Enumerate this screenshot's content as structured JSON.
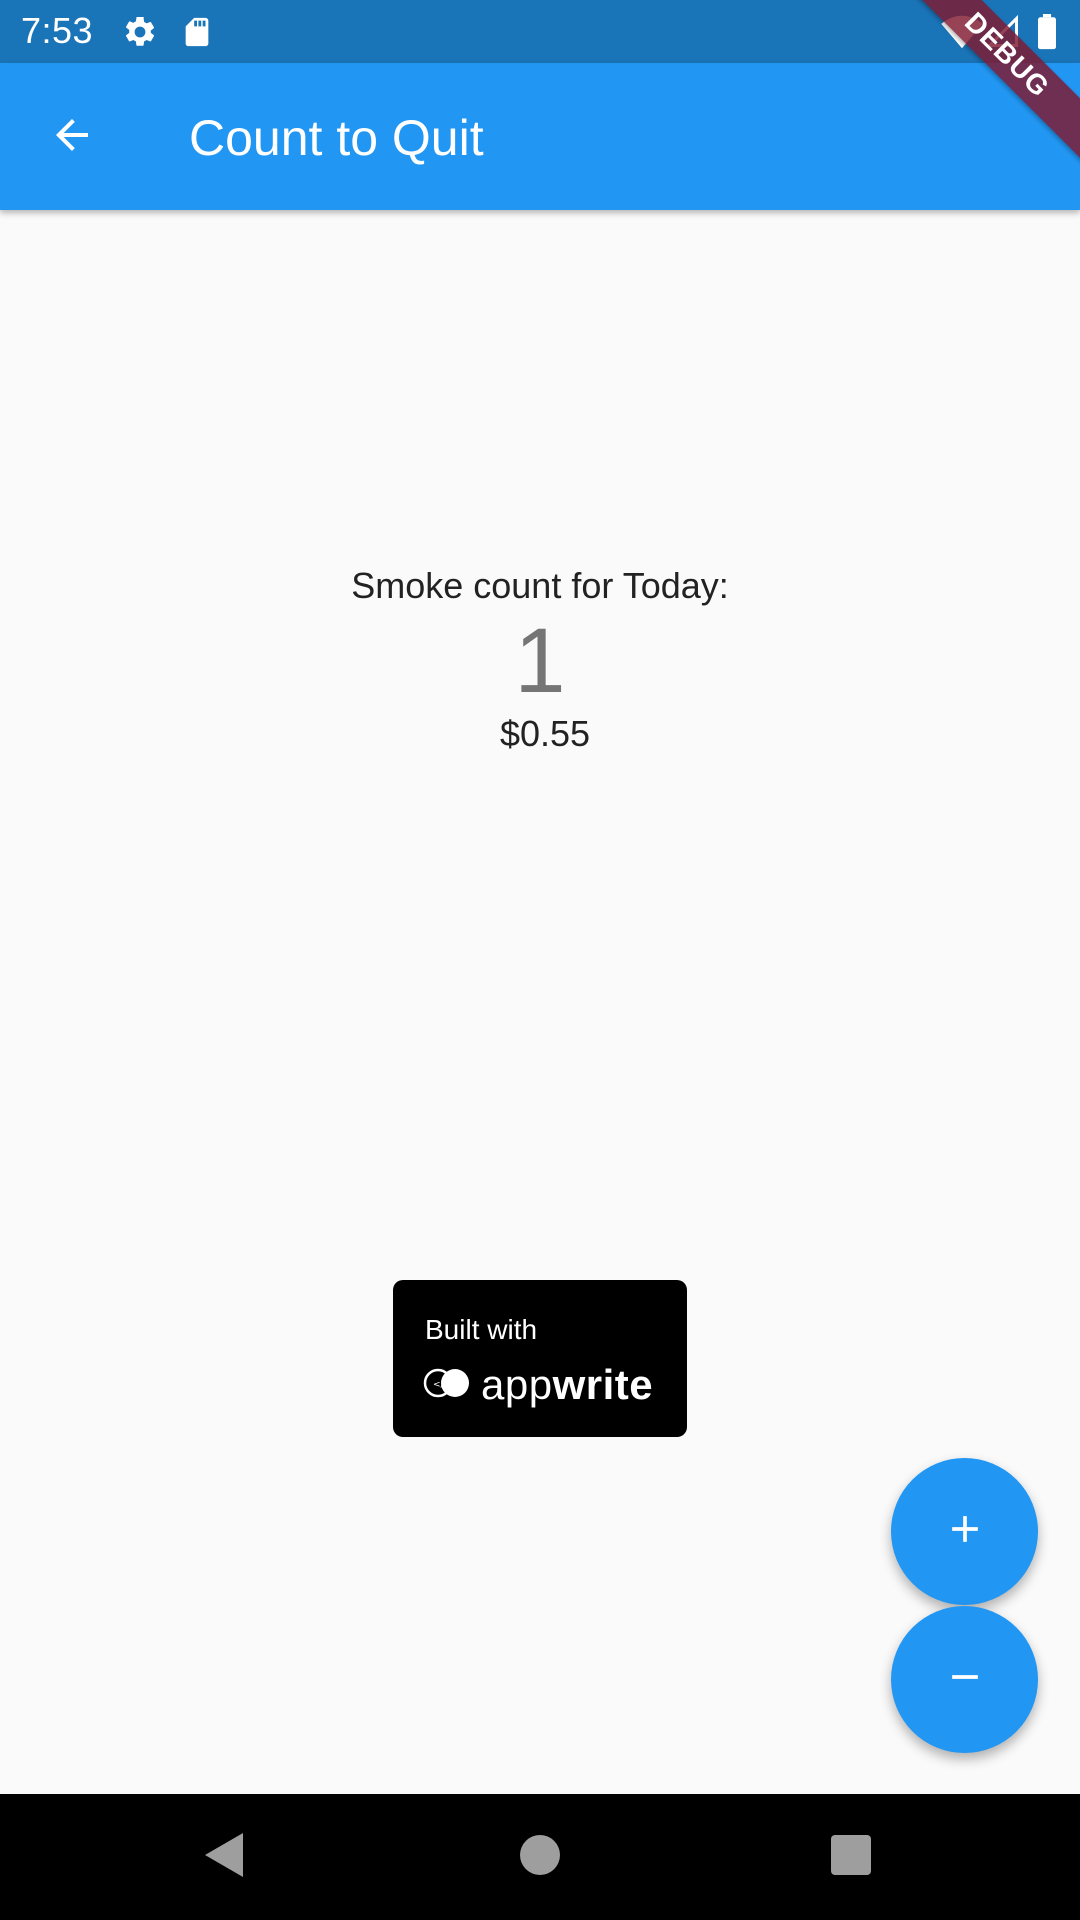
{
  "status_bar": {
    "time": "7:53",
    "icons": [
      "gear-icon",
      "sd-card-icon",
      "wifi-icon",
      "signal-icon",
      "battery-icon"
    ]
  },
  "app_bar": {
    "title": "Count to Quit",
    "back_icon": "arrow-back-icon",
    "color": "#2196f3"
  },
  "debug_banner": {
    "label": "DEBUG"
  },
  "counter": {
    "label": "Smoke count for Today:",
    "count": "1",
    "cost": "$0.55"
  },
  "badge": {
    "built_with": "Built with",
    "brand_light": "app",
    "brand_bold": "write"
  },
  "fabs": {
    "increment_icon": "plus-icon",
    "decrement_icon": "minus-icon",
    "color": "#2196f3"
  },
  "nav_bar": {
    "buttons": [
      "back-triangle-icon",
      "home-circle-icon",
      "recents-square-icon"
    ]
  }
}
